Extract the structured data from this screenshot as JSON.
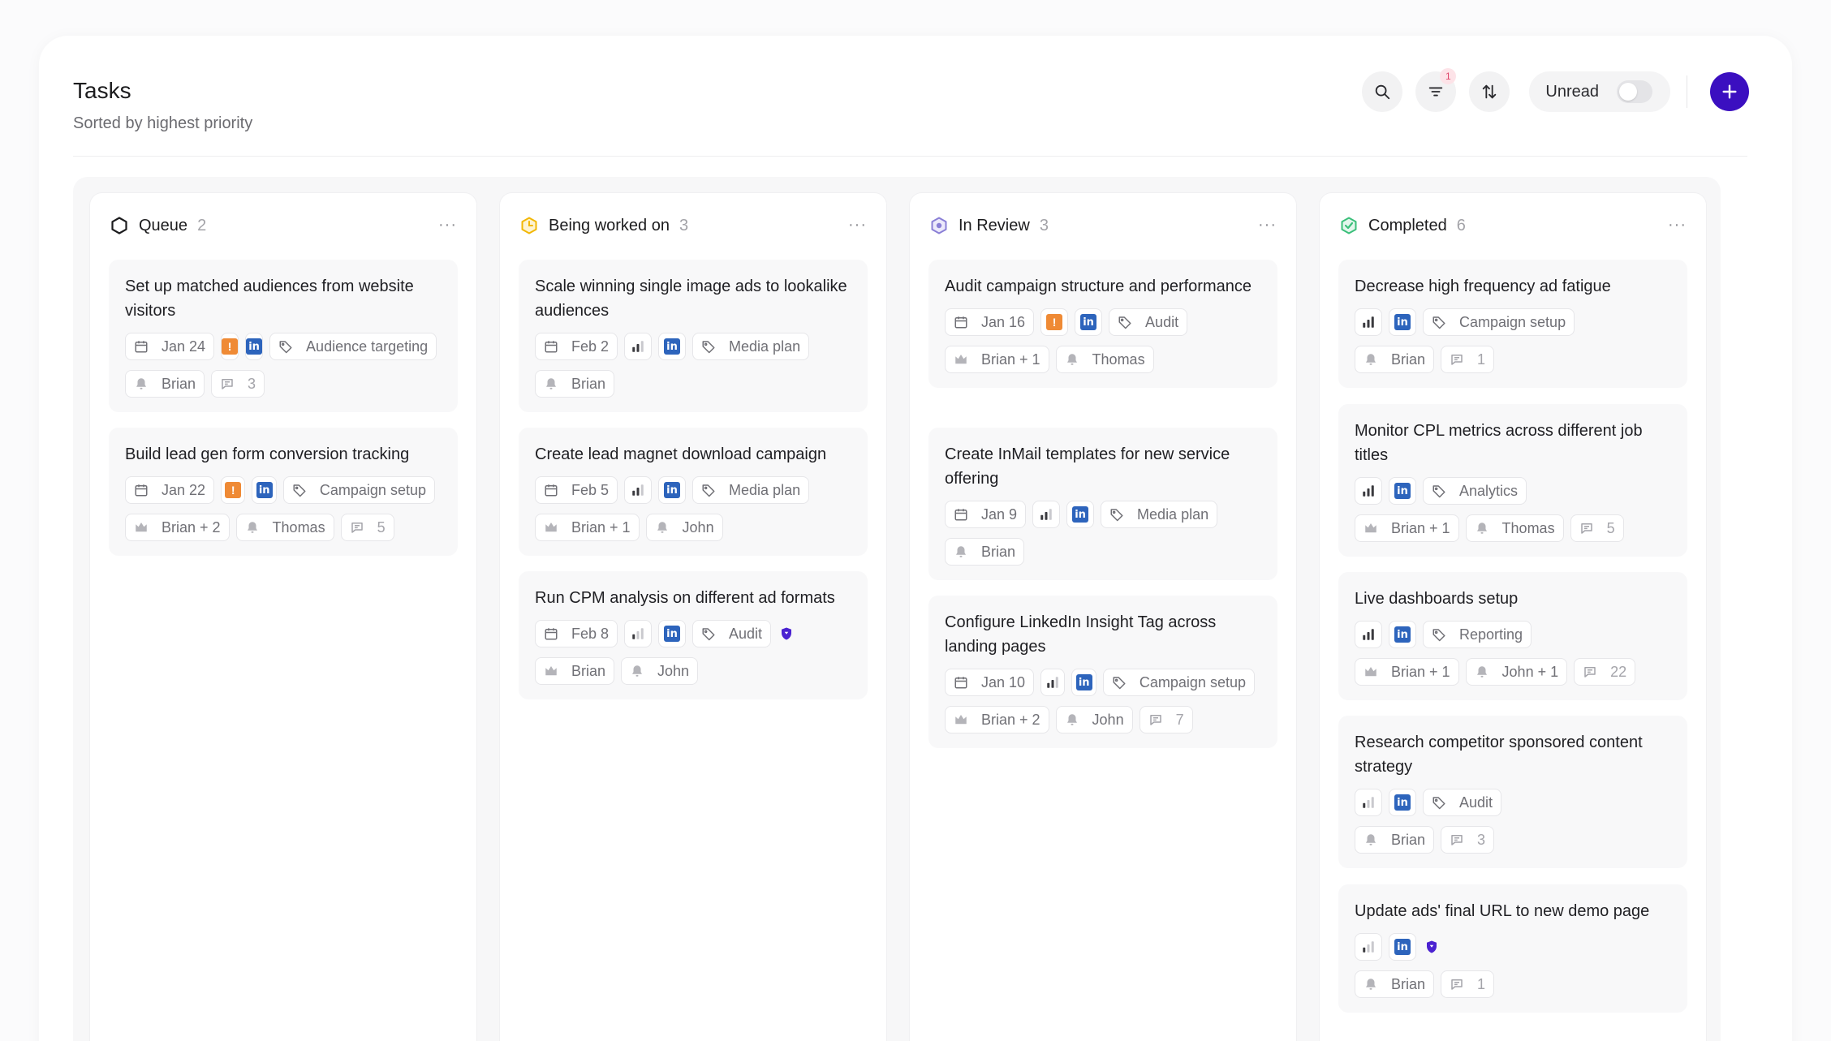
{
  "header": {
    "title": "Tasks",
    "subtitle": "Sorted by highest priority",
    "filter_badge": "1",
    "unread_label": "Unread",
    "unread_toggle": "off"
  },
  "colors": {
    "accent": "#3b0fc0",
    "linkedin": "#2d64bc",
    "urgent": "#ef8a35",
    "queue": "#1c1c1e",
    "in_progress": "#f2b705",
    "in_review": "#8a7fd6",
    "completed": "#3bbf7a"
  },
  "columns": [
    {
      "title": "Queue",
      "count": "2",
      "status_icon": "hexagon-outline-icon",
      "cards": [
        {
          "title": "Set up matched audiences from website visitors",
          "date": "Jan 24",
          "priority": "urgent",
          "tag": "Audience targeting",
          "owners": "Brian",
          "comments": "3"
        },
        {
          "title": "Build lead gen form conversion tracking",
          "date": "Jan 22",
          "priority": "urgent",
          "tag": "Campaign setup",
          "assignees": "Brian + 2",
          "owners": "Thomas",
          "comments": "5"
        }
      ]
    },
    {
      "title": "Being worked on",
      "count": "3",
      "status_icon": "in-progress-icon",
      "cards": [
        {
          "title": "Scale winning single image ads to lookalike audiences",
          "date": "Feb 2",
          "priority": "medium",
          "tag": "Media plan",
          "owners": "Brian"
        },
        {
          "title": "Create lead magnet download campaign",
          "date": "Feb 5",
          "priority": "medium",
          "tag": "Media plan",
          "assignees": "Brian + 1",
          "owners": "John"
        },
        {
          "title": "Run CPM analysis on different ad formats",
          "date": "Feb 8",
          "priority": "low",
          "tag": "Audit",
          "assignees": "Brian",
          "owners": "John"
        }
      ]
    },
    {
      "title": "In Review",
      "count": "3",
      "status_icon": "in-review-icon",
      "cards": [
        {
          "title": "Audit campaign structure and performance",
          "date": "Jan 16",
          "priority": "urgent",
          "tag": "Audit",
          "assignees": "Brian + 1",
          "owners": "Thomas"
        },
        {
          "title": "Create InMail templates for new service offering",
          "date": "Jan 9",
          "priority": "medium",
          "tag": "Media plan",
          "owners": "Brian"
        },
        {
          "title": "Configure LinkedIn Insight Tag across landing pages",
          "date": "Jan 10",
          "priority": "medium",
          "tag": "Campaign setup",
          "assignees": "Brian + 2",
          "owners": "John",
          "comments": "7"
        }
      ]
    },
    {
      "title": "Completed",
      "count": "6",
      "status_icon": "completed-check-icon",
      "cards": [
        {
          "title": "Decrease high frequency ad fatigue",
          "priority": "high",
          "tag": "Campaign setup",
          "owners": "Brian",
          "comments": "1"
        },
        {
          "title": "Monitor CPL metrics across different job titles",
          "priority": "high",
          "tag": "Analytics",
          "assignees": "Brian + 1",
          "owners": "Thomas",
          "comments": "5"
        },
        {
          "title": "Live dashboards setup",
          "priority": "high",
          "tag": "Reporting",
          "assignees": "Brian + 1",
          "owners": "John + 1",
          "comments": "22"
        },
        {
          "title": "Research competitor sponsored content strategy",
          "priority": "low",
          "tag": "Audit",
          "owners": "Brian",
          "comments": "3"
        },
        {
          "title": "Update ads' final URL to new demo page",
          "priority": "low",
          "owners": "Brian",
          "comments": "1"
        }
      ]
    }
  ]
}
